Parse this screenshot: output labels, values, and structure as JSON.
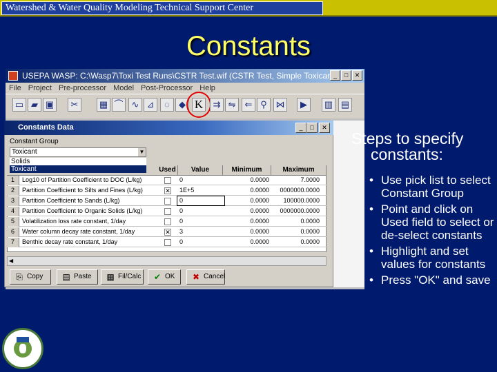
{
  "header": {
    "title": "Watershed & Water Quality Modeling Technical Support Center"
  },
  "slide": {
    "title": "Constants"
  },
  "app_window": {
    "title": "USEPA WASP: C:\\Wasp7\\Toxi Test Runs\\CSTR Test.wif (CSTR Test, Simple Toxicant)",
    "menu": [
      "File",
      "Project",
      "Pre-processor",
      "Model",
      "Post-Processor",
      "Help"
    ],
    "constants_button_label": "K"
  },
  "dialog": {
    "title": "Constants Data",
    "group_label": "Constant Group",
    "group_selected": "Toxicant",
    "group_options": [
      "Solids",
      "Toxicant"
    ],
    "columns": [
      "Used",
      "Value",
      "Minimum",
      "Maximum"
    ],
    "rows": [
      {
        "num": "1",
        "desc": "Log10 of Partition Coefficient to DOC (L/kg)",
        "used": false,
        "value": "0",
        "min": "0.0000",
        "max": "7.0000"
      },
      {
        "num": "2",
        "desc": "Partition Coefficient to Silts and Fines (L/kg)",
        "used": true,
        "value": "1E+5",
        "min": "0.0000",
        "max": "0000000.0000"
      },
      {
        "num": "3",
        "desc": "Partition Coefficient to Sands (L/kg)",
        "used": false,
        "value": "0",
        "min": "0.0000",
        "max": "100000.0000"
      },
      {
        "num": "4",
        "desc": "Partition Coefficient to Organic Solids (L/kg)",
        "used": false,
        "value": "0",
        "min": "0.0000",
        "max": "0000000.0000"
      },
      {
        "num": "5",
        "desc": "Volatilization loss rate constant, 1/day",
        "used": false,
        "value": "0",
        "min": "0.0000",
        "max": "0.0000"
      },
      {
        "num": "6",
        "desc": "Water column decay rate constant, 1/day",
        "used": true,
        "value": "3",
        "min": "0.0000",
        "max": "0.0000"
      },
      {
        "num": "7",
        "desc": "Benthic decay rate constant, 1/day",
        "used": false,
        "value": "0",
        "min": "0.0000",
        "max": "0.0000"
      }
    ],
    "buttons": {
      "copy": "Copy",
      "paste": "Paste",
      "fillcalc": "Fil/Calc",
      "ok": "OK",
      "cancel": "Cancel"
    }
  },
  "instructions": {
    "heading_line1": "Steps to specify",
    "heading_line2": "constants:",
    "steps": [
      "Use pick list to select Constant Group",
      "Point and click on Used field to select or de-select constants",
      "Highlight and set values for constants",
      "Press \"OK\" and save"
    ]
  },
  "colors": {
    "background": "#001a6e",
    "title": "#ffff66",
    "highlight_circle": "#e00000"
  }
}
